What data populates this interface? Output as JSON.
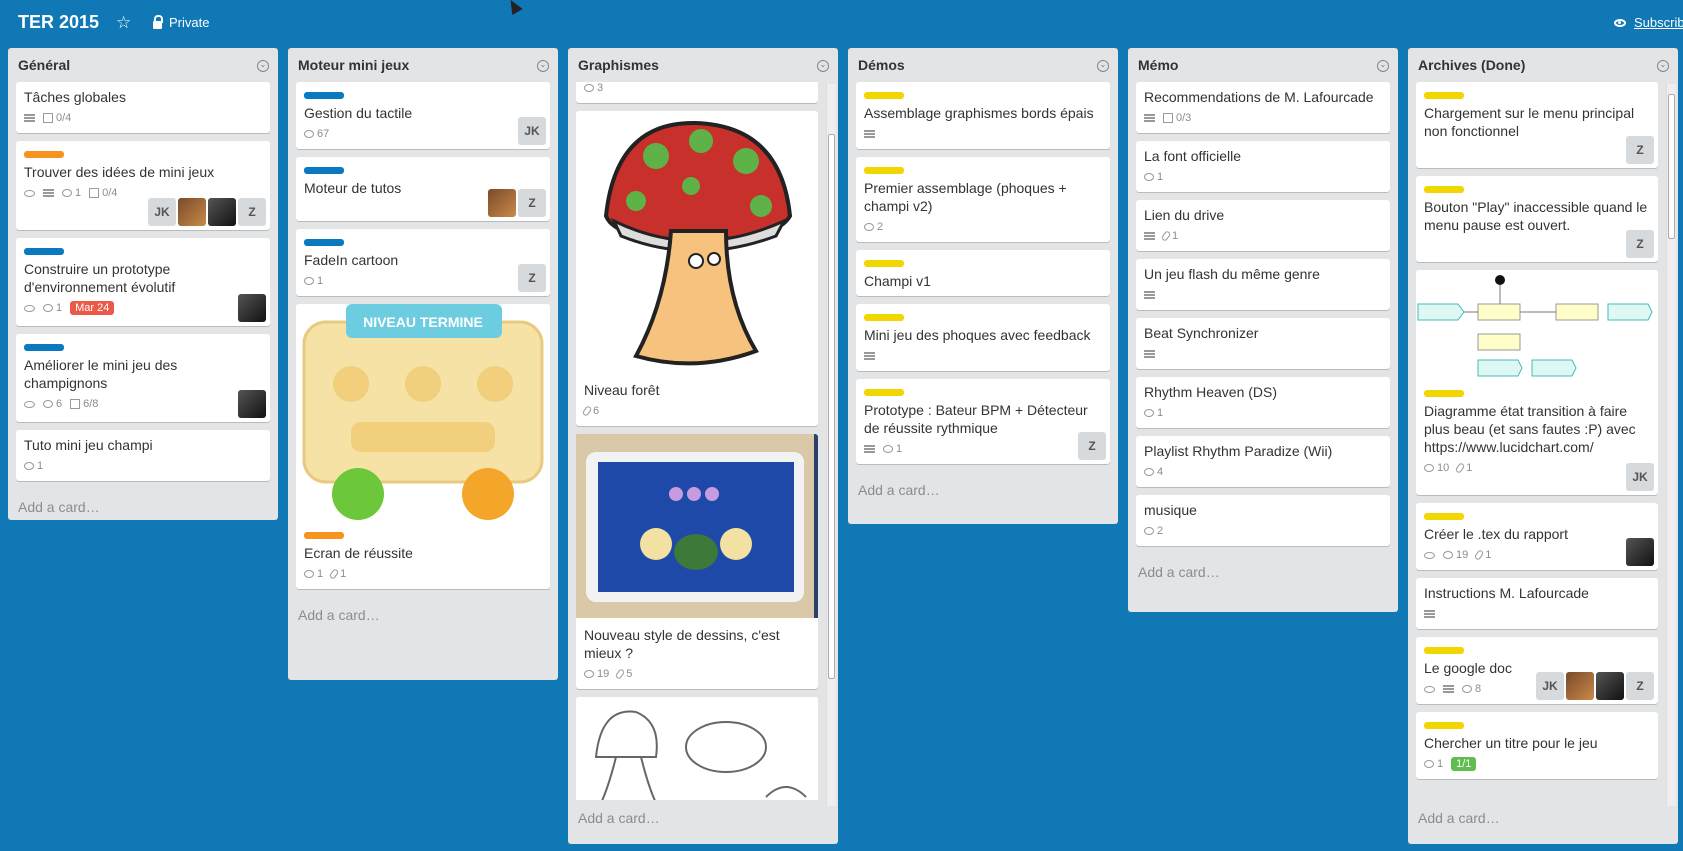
{
  "header": {
    "board_title": "TER 2015",
    "visibility": "Private",
    "subscribe": "Subscribe"
  },
  "colors": {
    "background": "#0f78b5",
    "list": "#e2e4e6",
    "label_orange": "#f6941d",
    "label_blue": "#0a79bf",
    "label_yellow": "#f2d600",
    "due": "#eb5a46",
    "checklist_done": "#61bd4f"
  },
  "lists": [
    {
      "title": "Général",
      "add": "Add a card…",
      "cards": [
        {
          "title": "Tâches globales",
          "checklist": "0/4"
        },
        {
          "title": "Trouver des idées de mini jeux",
          "label": "orange",
          "comments": "1",
          "checklist": "0/4",
          "members": [
            "JK",
            "Z"
          ]
        },
        {
          "title": "Construire un prototype d'environnement évolutif",
          "label": "blue",
          "comments": "1",
          "due": "Mar 24"
        },
        {
          "title": "Améliorer le mini jeu des champignons",
          "label": "blue",
          "comments": "6",
          "checklist": "6/8"
        },
        {
          "title": "Tuto mini jeu champi",
          "comments": "1"
        }
      ]
    },
    {
      "title": "Moteur mini jeux",
      "add": "Add a card…",
      "cards": [
        {
          "title": "Gestion du tactile",
          "label": "blue",
          "comments": "67",
          "members": [
            "JK"
          ]
        },
        {
          "title": "Moteur de tutos",
          "label": "blue",
          "members": [
            "Z"
          ]
        },
        {
          "title": "FadeIn cartoon",
          "label": "blue",
          "comments": "1",
          "members": [
            "Z"
          ]
        },
        {
          "title": "Ecran de réussite",
          "cover": "NIVEAU TERMINE",
          "label": "orange",
          "comments": "1",
          "attachments": "1"
        }
      ]
    },
    {
      "title": "Graphismes",
      "add": "Add a card…",
      "cards": [
        {
          "comments": "3"
        },
        {
          "title": "Niveau forêt",
          "attachments": "6"
        },
        {
          "title": "Nouveau style de dessins, c'est mieux ?",
          "comments": "19",
          "attachments": "5"
        }
      ]
    },
    {
      "title": "Démos",
      "add": "Add a card…",
      "cards": [
        {
          "title": "Assemblage graphismes bords épais",
          "label": "yellow"
        },
        {
          "title": "Premier assemblage (phoques + champi v2)",
          "label": "yellow",
          "comments": "2"
        },
        {
          "title": "Champi v1",
          "label": "yellow"
        },
        {
          "title": "Mini jeu des phoques avec feedback",
          "label": "yellow"
        },
        {
          "title": "Prototype : Bateur BPM + Détecteur de réussite rythmique",
          "label": "yellow",
          "comments": "1",
          "members": [
            "Z"
          ]
        }
      ]
    },
    {
      "title": "Mémo",
      "add": "Add a card…",
      "cards": [
        {
          "title": "Recommendations de M. Lafourcade",
          "checklist": "0/3"
        },
        {
          "title": "La font officielle",
          "comments": "1"
        },
        {
          "title": "Lien du drive",
          "attachments": "1"
        },
        {
          "title": "Un jeu flash du même genre"
        },
        {
          "title": "Beat Synchronizer"
        },
        {
          "title": "Rhythm Heaven (DS)",
          "comments": "1"
        },
        {
          "title": "Playlist Rhythm Paradize (Wii)",
          "comments": "4"
        },
        {
          "title": "musique",
          "comments": "2"
        }
      ]
    },
    {
      "title": "Archives (Done)",
      "add": "Add a card…",
      "cards": [
        {
          "title": "Chargement sur le menu principal non fonctionnel",
          "label": "yellow",
          "members": [
            "Z"
          ]
        },
        {
          "title": "Bouton \"Play\" inaccessible quand le menu pause est ouvert.",
          "label": "yellow",
          "members": [
            "Z"
          ]
        },
        {
          "title": "Diagramme état transition à faire plus beau (et sans fautes :P) avec https://www.lucidchart.com/",
          "label": "yellow",
          "comments": "10",
          "attachments": "1",
          "members": [
            "JK"
          ]
        },
        {
          "title": "Créer le .tex du rapport",
          "label": "yellow",
          "comments": "19",
          "attachments": "1"
        },
        {
          "title": "Instructions M. Lafourcade"
        },
        {
          "title": "Le google doc",
          "label": "yellow",
          "comments": "8",
          "members": [
            "JK",
            "Z"
          ]
        },
        {
          "title": "Chercher un titre pour le jeu",
          "label": "yellow",
          "comments": "1",
          "checklist": "1/1"
        }
      ]
    }
  ]
}
